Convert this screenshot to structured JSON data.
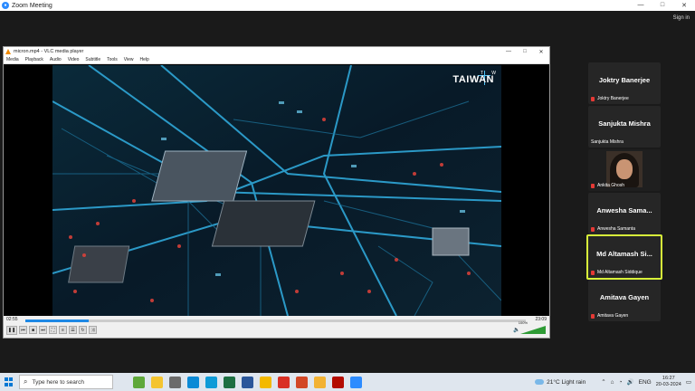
{
  "zoom": {
    "title": "Zoom Meeting",
    "sign_in": "Sign in"
  },
  "window_controls": {
    "minimize": "—",
    "maximize": "□",
    "close": "✕"
  },
  "vlc": {
    "title": "micron.mp4 - VLC media player",
    "menu": [
      "Media",
      "Playback",
      "Audio",
      "Video",
      "Subtitle",
      "Tools",
      "View",
      "Help"
    ],
    "video_brand": "TAIWAN",
    "brand_t": "T",
    "brand_w": "W",
    "time_elapsed": "02:55",
    "time_total": "23:09",
    "progress": 0.126,
    "volume_label": "100%",
    "volume_level": 1.0
  },
  "participants": [
    {
      "name": "Joktry Banerjee",
      "label": "Joktry Banerjee",
      "muted": true,
      "video": false
    },
    {
      "name": "Sanjukta Mishra",
      "label": "Sanjukta Mishra",
      "muted": false,
      "video": false
    },
    {
      "name": "",
      "label": "Ankita Ghosh",
      "muted": true,
      "video": true
    },
    {
      "name": "Anwesha Sama...",
      "label": "Anwesha Samanta",
      "muted": true,
      "video": false
    },
    {
      "name": "Md Altamash Si...",
      "label": "Md Altamash Siddique",
      "muted": true,
      "video": false,
      "active": true
    },
    {
      "name": "Amitava Gayen",
      "label": "Amitava Gayen",
      "muted": true,
      "video": false
    }
  ],
  "taskbar": {
    "search_placeholder": "Type here to search",
    "weather": "21°C  Light rain",
    "lang": "ENG",
    "time": "16:27",
    "date": "20-03-2024",
    "app_colors": [
      "#5fa83a",
      "#f4c430",
      "#6b6b6b",
      "#0b8ad6",
      "#0f9bd7",
      "#1d6f42",
      "#2b579a",
      "#f3b900",
      "#d93025",
      "#d24726",
      "#f2b233",
      "#b30b00",
      "#2d8cff"
    ]
  }
}
